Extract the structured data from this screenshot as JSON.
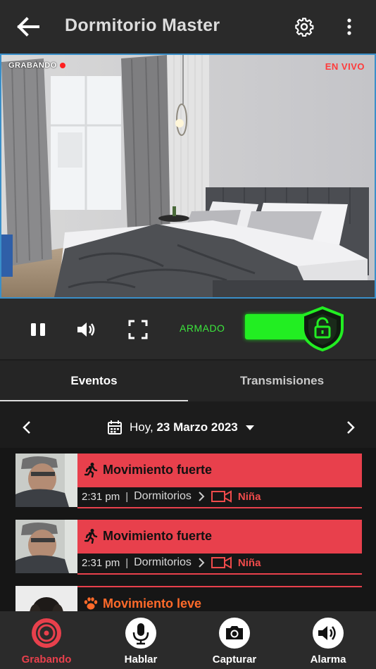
{
  "header": {
    "title": "Dormitorio Master",
    "back_icon": "arrow-left-icon",
    "settings_icon": "gear-icon",
    "more_icon": "more-vertical-icon"
  },
  "video": {
    "recording_label": "GRABANDO",
    "live_label": "EN VIVO"
  },
  "controls": {
    "pause_icon": "pause-icon",
    "volume_icon": "volume-icon",
    "fullscreen_icon": "fullscreen-icon",
    "armed_label": "ARMADO",
    "armed_state": true,
    "colors": {
      "armed": "#22ee22"
    }
  },
  "tabs": [
    {
      "label": "Eventos",
      "active": true
    },
    {
      "label": "Transmisiones",
      "active": false
    }
  ],
  "date": {
    "prefix": "Hoy,",
    "value": "23 Marzo 2023"
  },
  "events": [
    {
      "title": "Movimiento fuerte",
      "time": "2:31 pm",
      "sep": "|",
      "place": "Dormitorios",
      "camera": "Niña",
      "icon": "running-person-icon"
    },
    {
      "title": "Movimiento fuerte",
      "time": "2:31 pm",
      "sep": "|",
      "place": "Dormitorios",
      "camera": "Niña",
      "icon": "running-person-icon"
    },
    {
      "title": "Movimiento leve",
      "icon": "paw-icon"
    }
  ],
  "bottom_nav": [
    {
      "label": "Grabando",
      "icon": "record-icon",
      "active": true
    },
    {
      "label": "Hablar",
      "icon": "microphone-icon",
      "active": false
    },
    {
      "label": "Capturar",
      "icon": "camera-icon",
      "active": false
    },
    {
      "label": "Alarma",
      "icon": "speaker-icon",
      "active": false
    }
  ],
  "colors": {
    "accent": "#e8404c",
    "live": "#ff3b3b",
    "warning": "#ff6a2a"
  }
}
